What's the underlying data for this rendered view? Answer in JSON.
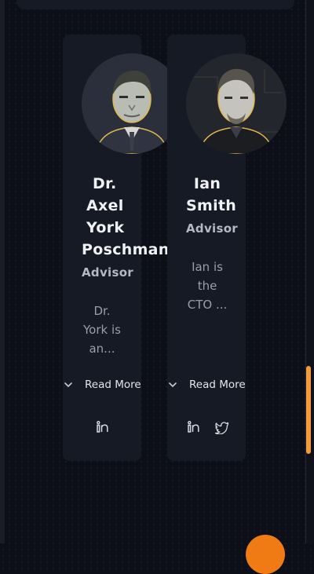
{
  "advisors": [
    {
      "name_lines": [
        "Dr.",
        "Axel",
        "York",
        "Poschmann"
      ],
      "role": "Advisor",
      "bio_lines": [
        "Dr.",
        "York is",
        "an..."
      ],
      "read_more": "Read More",
      "socials": [
        "linkedin-icon"
      ]
    },
    {
      "name_lines": [
        "Ian",
        "Smith"
      ],
      "role": "Advisor",
      "bio_lines": [
        "Ian is",
        "the",
        "CTO ..."
      ],
      "read_more": "Read More",
      "socials": [
        "linkedin-icon",
        "twitter-icon"
      ]
    }
  ],
  "colors": {
    "accent": "#f39a3a",
    "background": "#0c0f17",
    "card": "#161a24"
  }
}
